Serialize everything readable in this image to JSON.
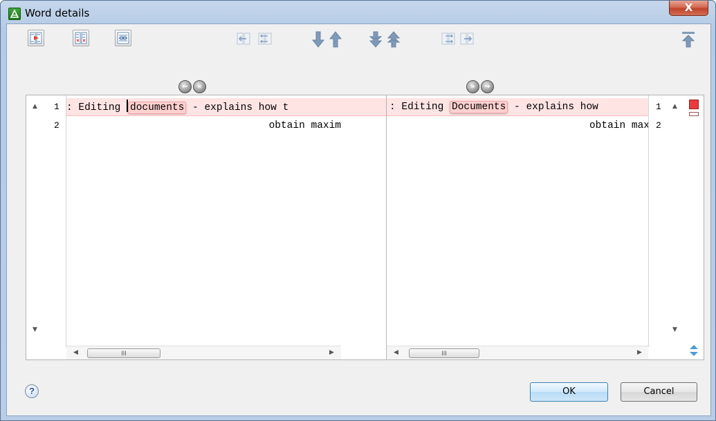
{
  "window": {
    "title": "Word details",
    "close_label": "X"
  },
  "toolbar": {
    "icons": [
      "compare-icon",
      "diff-options-icon",
      "link-scroll-icon",
      "copy-left-icon",
      "copy-all-left-icon",
      "next-change-icon",
      "previous-change-icon",
      "next-block-icon",
      "previous-block-icon",
      "copy-all-right-icon",
      "copy-right-icon",
      "first-change-icon"
    ]
  },
  "left_pane": {
    "lines": [
      {
        "number": "1",
        "before": ": Editing ",
        "word": "documents",
        "after": " - explains how t"
      },
      {
        "number": "2",
        "text": "obtain maxim"
      }
    ],
    "scroll_thumb": "III"
  },
  "right_pane": {
    "lines": [
      {
        "number": "1",
        "before": ": Editing ",
        "word": "Documents",
        "after": " - explains how"
      },
      {
        "number": "2",
        "text": "obtain max"
      }
    ],
    "scroll_thumb": "III"
  },
  "colors": {
    "change_highlight": "#ffe4e4",
    "word_highlight": "#ffd0d0",
    "overview_mark": "#e83b3b"
  },
  "buttons": {
    "help": "?",
    "ok": "OK",
    "cancel": "Cancel"
  }
}
